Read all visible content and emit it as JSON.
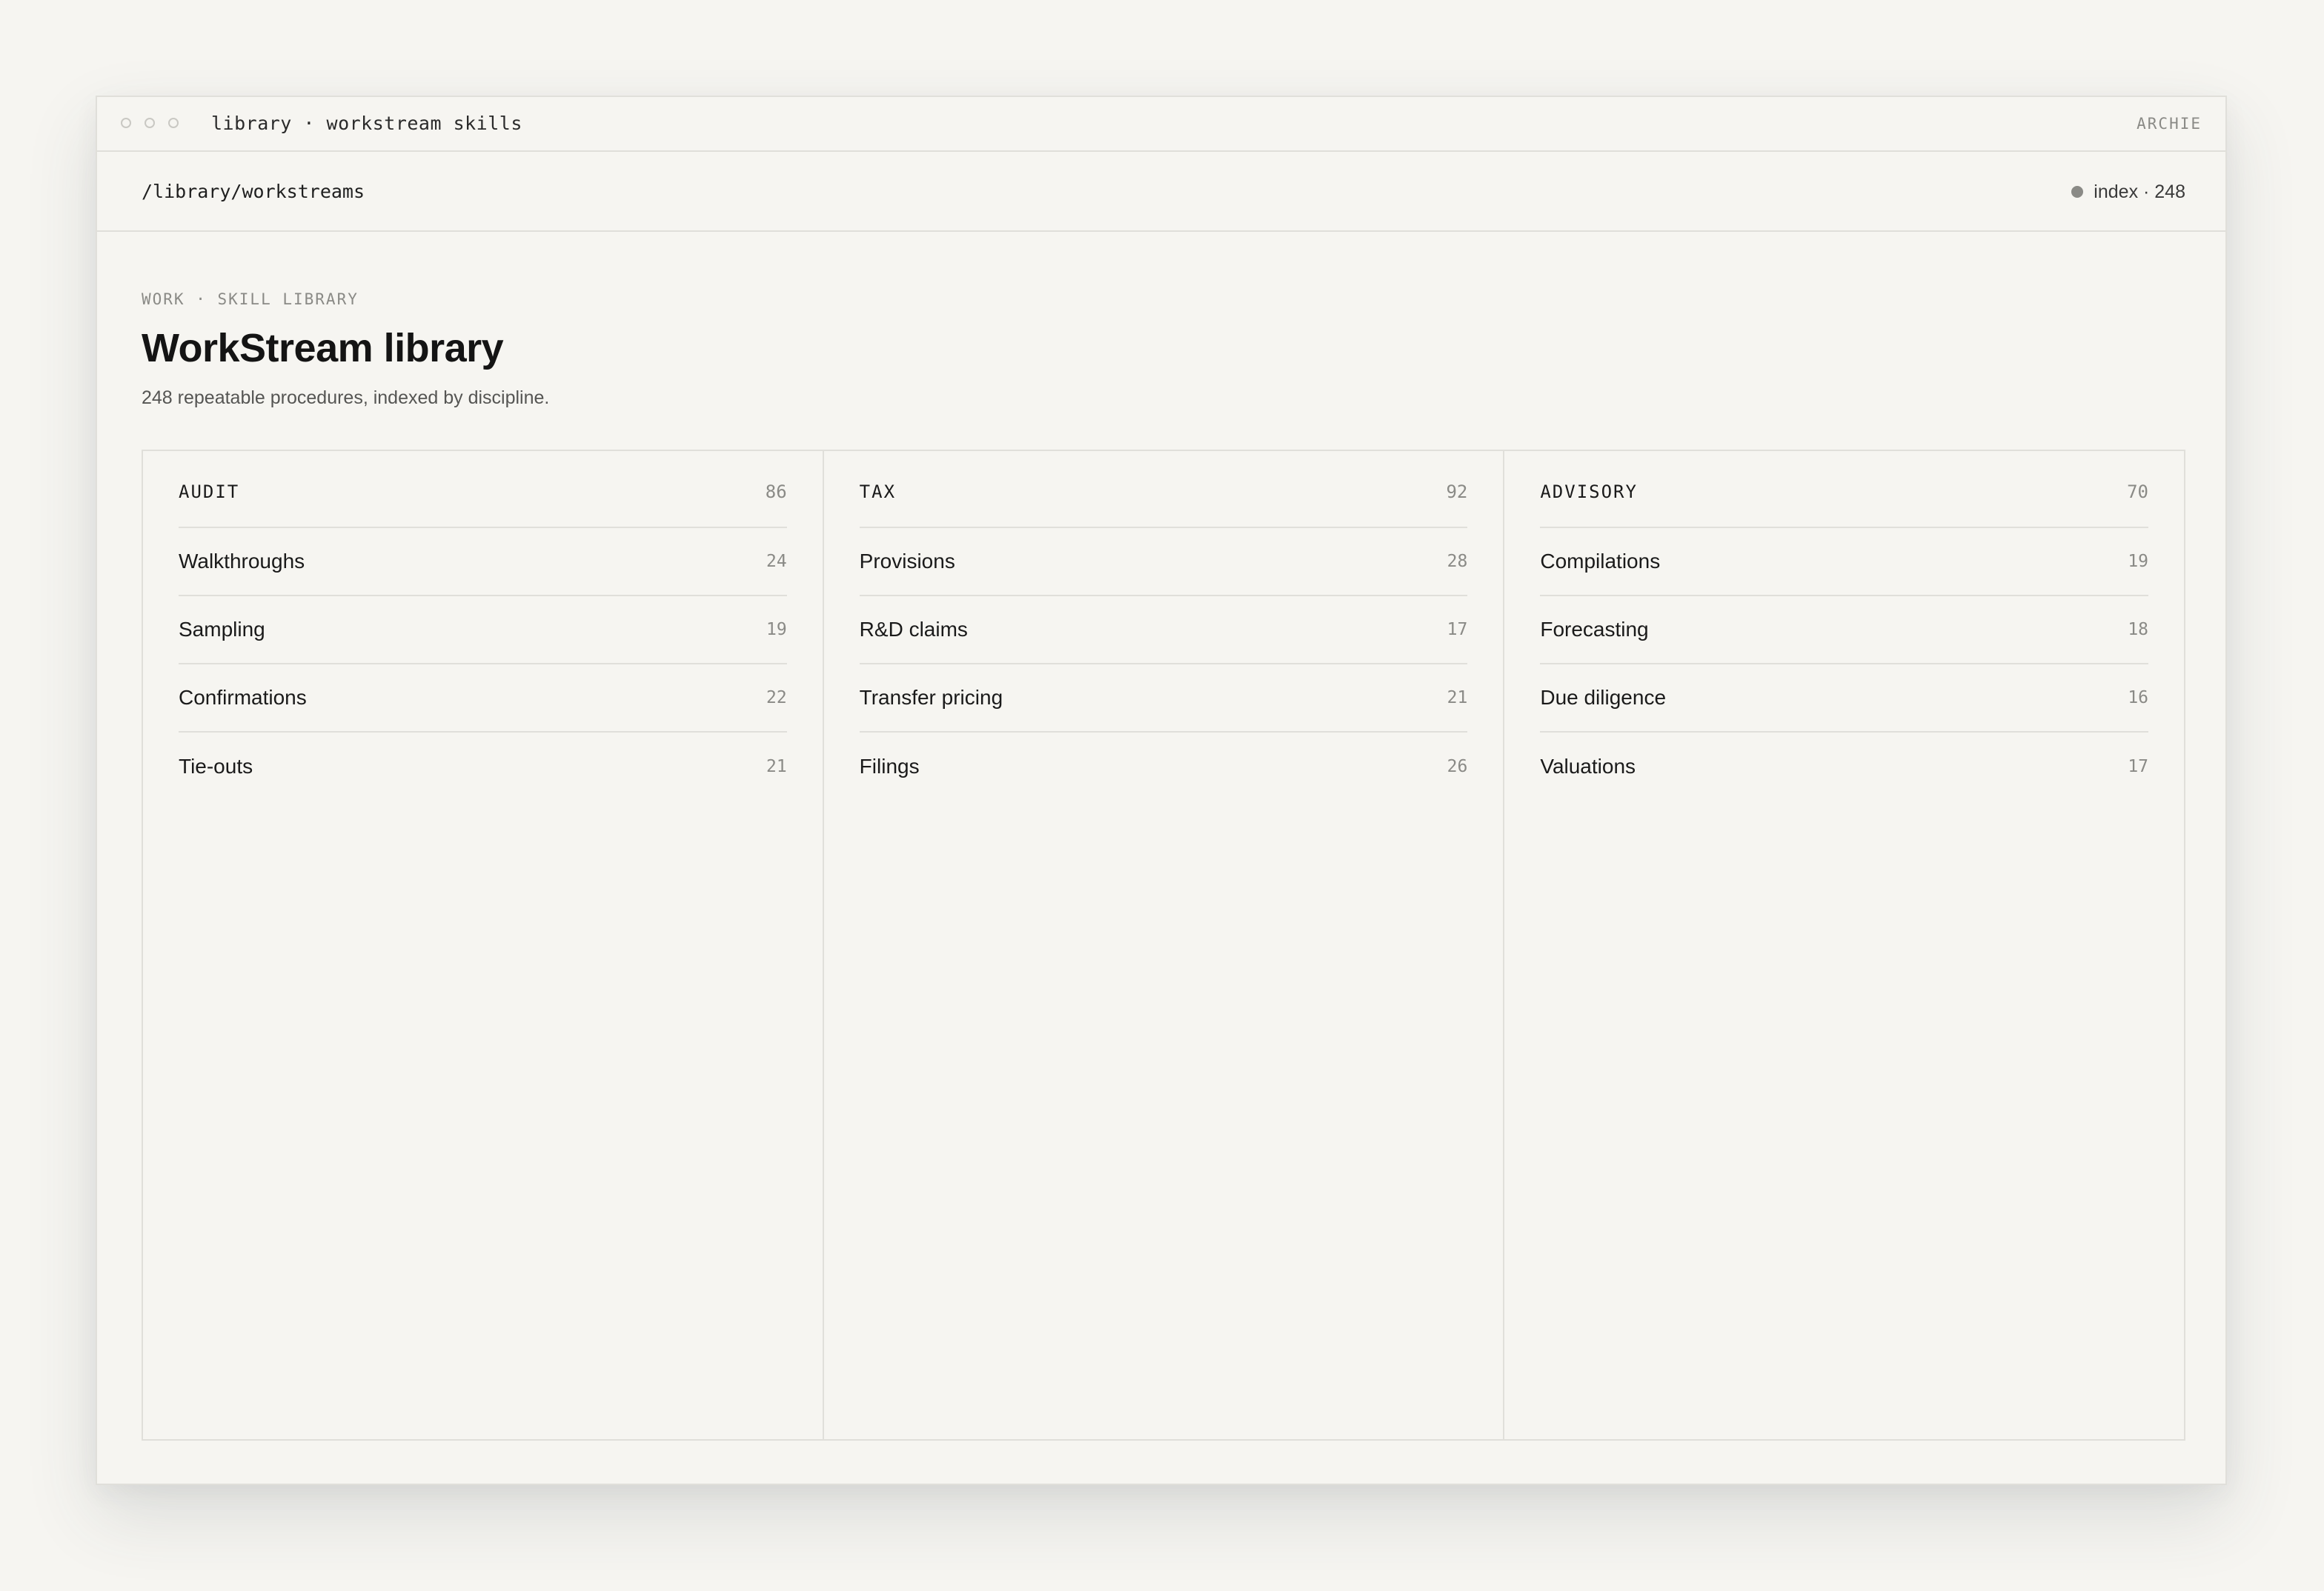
{
  "window": {
    "title": "library · workstream skills",
    "brand": "ARCHIE"
  },
  "pathbar": {
    "path": "/library/workstreams",
    "index_label": "index · 248"
  },
  "header": {
    "eyebrow": "WORK · SKILL LIBRARY",
    "title": "WorkStream library",
    "subtitle": "248 repeatable procedures, indexed by discipline."
  },
  "columns": [
    {
      "name": "AUDIT",
      "count": "86",
      "items": [
        {
          "label": "Walkthroughs",
          "count": "24"
        },
        {
          "label": "Sampling",
          "count": "19"
        },
        {
          "label": "Confirmations",
          "count": "22"
        },
        {
          "label": "Tie-outs",
          "count": "21"
        }
      ]
    },
    {
      "name": "TAX",
      "count": "92",
      "items": [
        {
          "label": "Provisions",
          "count": "28"
        },
        {
          "label": "R&D claims",
          "count": "17"
        },
        {
          "label": "Transfer pricing",
          "count": "21"
        },
        {
          "label": "Filings",
          "count": "26"
        }
      ]
    },
    {
      "name": "ADVISORY",
      "count": "70",
      "items": [
        {
          "label": "Compilations",
          "count": "19"
        },
        {
          "label": "Forecasting",
          "count": "18"
        },
        {
          "label": "Due diligence",
          "count": "16"
        },
        {
          "label": "Valuations",
          "count": "17"
        }
      ]
    }
  ]
}
